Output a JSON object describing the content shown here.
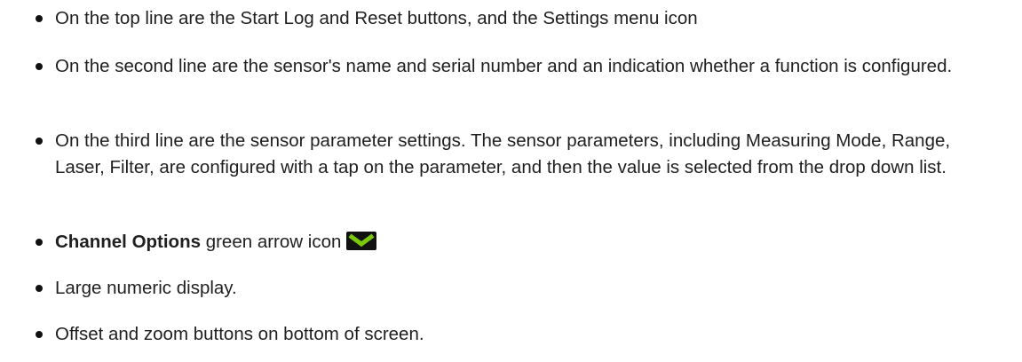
{
  "bullets": [
    {
      "text": "On the top line are the Start Log and Reset buttons, and the Settings menu icon"
    },
    {
      "text": "On the second line are the sensor's name and serial number and an indication whether a function is configured."
    },
    {
      "text": "On the third line are the sensor parameter settings. The sensor parameters, including Measuring Mode, Range, Laser, Filter, are configured with a tap on the parameter, and then the value is selected from the drop down list."
    },
    {
      "bold": "Channel Options",
      "text": " green arrow icon",
      "icon": "green-chevron-down-icon"
    },
    {
      "text": "Large numeric display."
    },
    {
      "text": "Offset and zoom buttons on bottom of screen."
    }
  ],
  "colors": {
    "icon_background": "#111111",
    "icon_arrow": "#7ac70c"
  }
}
